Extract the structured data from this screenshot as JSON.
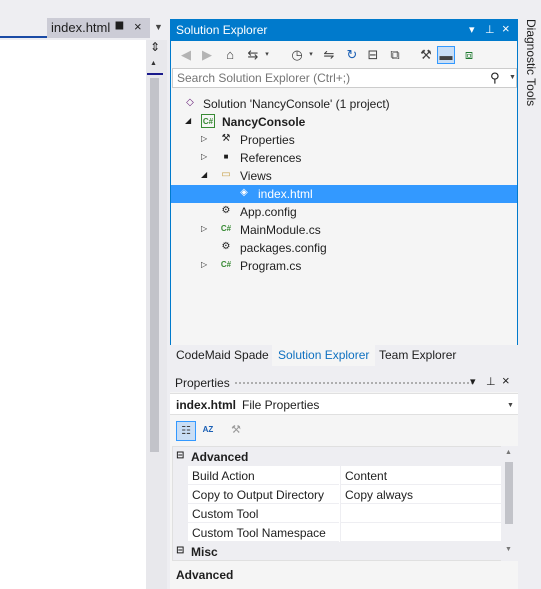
{
  "editor": {
    "tab_label": "index.html",
    "pin_glyph": "⯀",
    "close_glyph": "×",
    "dropdown_glyph": "▼",
    "split_glyph": "⇕",
    "scroll_up_glyph": "▲"
  },
  "solution_explorer": {
    "title": "Solution Explorer",
    "controls": {
      "dropdown": "▾",
      "pin": "⊥",
      "close": "×"
    },
    "toolbar": {
      "back": "◀",
      "forward": "▶",
      "home": "⌂",
      "switch_views": "⇆",
      "dd1": "▾",
      "pending_changes": "◷",
      "dd2": "▾",
      "sync": "⇋",
      "refresh": "↻",
      "collapse_all": "⊟",
      "show_all_files": "⧉",
      "properties": "⚒",
      "preview": "▬",
      "view_class_diagram": "⧈"
    },
    "search_placeholder": "Search Solution Explorer (Ctrl+;)",
    "search_icon": "⚲",
    "search_dropdown": "▼",
    "tree": [
      {
        "label": "Solution 'NancyConsole' (1 project)",
        "icon": "◇",
        "expander": "",
        "bold": false,
        "selected": false
      },
      {
        "label": "NancyConsole",
        "icon": "C#",
        "expander": "◢",
        "bold": true,
        "selected": false
      },
      {
        "label": "Properties",
        "icon": "⚒",
        "expander": "▷",
        "bold": false,
        "selected": false
      },
      {
        "label": "References",
        "icon": "■",
        "expander": "▷",
        "bold": false,
        "selected": false
      },
      {
        "label": "Views",
        "icon": "▭",
        "expander": "◢",
        "bold": false,
        "selected": false
      },
      {
        "label": "index.html",
        "icon": "◈",
        "expander": "",
        "bold": false,
        "selected": true
      },
      {
        "label": "App.config",
        "icon": "⚙",
        "expander": "",
        "bold": false,
        "selected": false
      },
      {
        "label": "MainModule.cs",
        "icon": "C#",
        "expander": "▷",
        "bold": false,
        "selected": false
      },
      {
        "label": "packages.config",
        "icon": "⚙",
        "expander": "",
        "bold": false,
        "selected": false
      },
      {
        "label": "Program.cs",
        "icon": "C#",
        "expander": "▷",
        "bold": false,
        "selected": false
      }
    ]
  },
  "bottom_tabs": {
    "codemaid": "CodeMaid Spade",
    "solution_explorer": "Solution Explorer",
    "team_explorer": "Team Explorer"
  },
  "properties": {
    "title": "Properties",
    "controls": {
      "dropdown": "▾",
      "pin": "⊥",
      "close": "×"
    },
    "object_name": "index.html",
    "object_type": "File Properties",
    "object_dropdown": "▼",
    "toolbar": {
      "categorized": "☷",
      "alphabetical": "AZ",
      "property_pages": "⚒"
    },
    "categories": [
      {
        "name": "Advanced",
        "expander": "⊟",
        "props": [
          {
            "name": "Build Action",
            "value": "Content"
          },
          {
            "name": "Copy to Output Directory",
            "value": "Copy always"
          },
          {
            "name": "Custom Tool",
            "value": ""
          },
          {
            "name": "Custom Tool Namespace",
            "value": ""
          }
        ]
      },
      {
        "name": "Misc",
        "expander": "⊟",
        "props": []
      }
    ],
    "scroll_up": "▲",
    "scroll_down": "▼",
    "description_title": "Advanced"
  },
  "diagnostic_tools": {
    "label": "Diagnostic Tools"
  }
}
